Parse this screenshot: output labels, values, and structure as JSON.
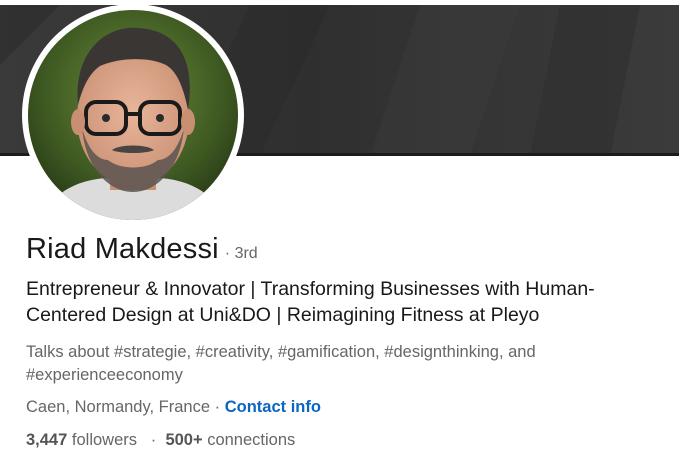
{
  "profile": {
    "name": "Riad Makdessi",
    "degree": "3rd",
    "headline": "Entrepreneur & Innovator | Transforming Businesses with Human-Centered Design at Uni&DO | Reimagining Fitness at Pleyo",
    "talks_about": "Talks about #strategie, #creativity, #gamification, #designthinking, and #experienceeconomy",
    "location": "Caen, Normandy, France",
    "contact_label": "Contact info",
    "followers_count": "3,447",
    "followers_label": "followers",
    "connections_count": "500+",
    "connections_label": "connections"
  },
  "colors": {
    "banner": "#333333",
    "link": "#0a66c2",
    "muted_text": "#666666",
    "primary_text": "#191919"
  }
}
